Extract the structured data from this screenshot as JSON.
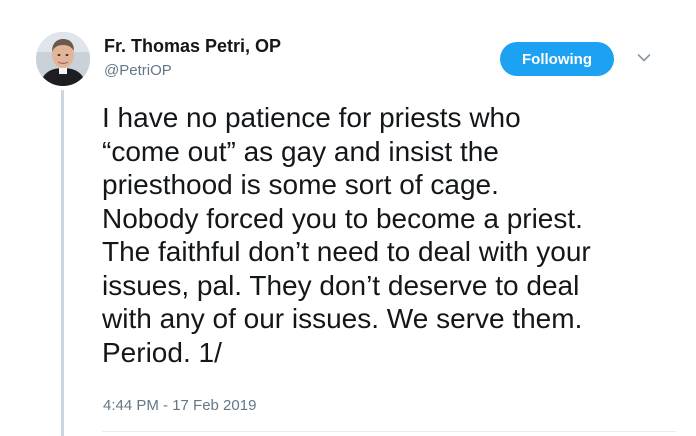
{
  "author": {
    "display_name": "Fr. Thomas Petri, OP",
    "handle": "@PetriOP"
  },
  "follow_button": {
    "label": "Following",
    "color": "#1da1f2"
  },
  "tweet": {
    "lines": [
      "I have no patience for priests who",
      "“come out” as gay and insist the",
      "priesthood is some sort of cage.",
      "Nobody forced you to become a priest.",
      "The faithful don’t need to deal with your",
      "issues, pal. They don’t deserve to deal",
      "with any of our issues. We serve them.",
      "Period. 1/"
    ],
    "timestamp": "4:44 PM - 17 Feb 2019"
  },
  "icons": {
    "menu": "chevron-down-icon",
    "avatar": "profile-photo"
  }
}
